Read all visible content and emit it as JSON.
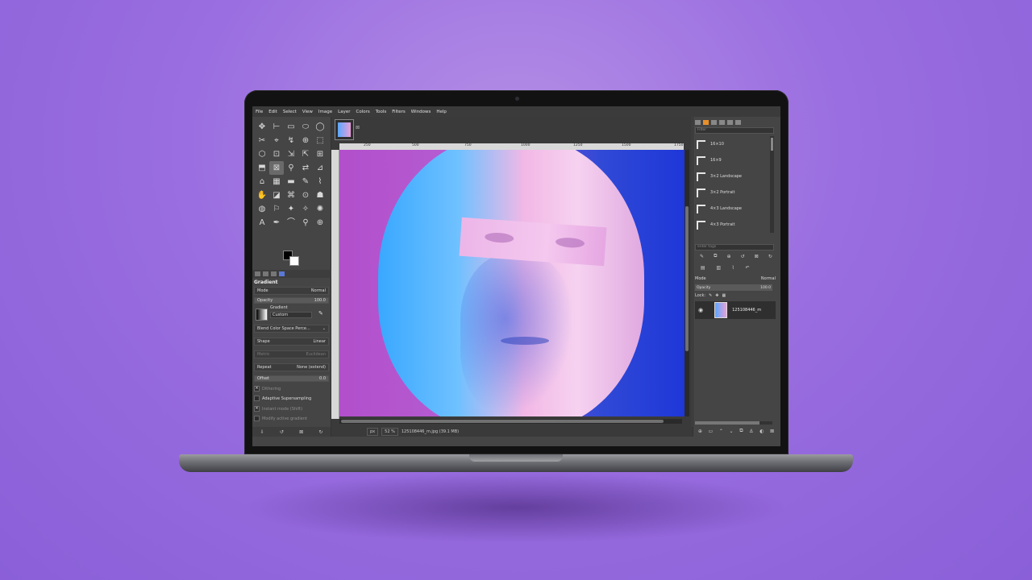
{
  "menu": [
    "File",
    "Edit",
    "Select",
    "View",
    "Image",
    "Layer",
    "Colors",
    "Tools",
    "Filters",
    "Windows",
    "Help"
  ],
  "tools": [
    "✥",
    "⊢",
    "▭",
    "⬭",
    "◯",
    "✂",
    "⌖",
    "↯",
    "⊕",
    "⬚",
    "⬡",
    "⊡",
    "⇲",
    "⇱",
    "⊞",
    "⬒",
    "⊠",
    "⚲",
    "⇄",
    "⊿",
    "⌂",
    "▦",
    "▬",
    "✎",
    "⌇",
    "✋",
    "◪",
    "⌘",
    "⊙",
    "☗",
    "◍",
    "⚐",
    "✦",
    "✧",
    "✺",
    "A",
    "✒",
    "⌒",
    "⚲",
    "⊕"
  ],
  "tool_options": {
    "title": "Gradient",
    "mode_label": "Mode",
    "mode_value": "Normal",
    "opacity_label": "Opacity",
    "opacity_value": "100.0",
    "gradient_label": "Gradient",
    "gradient_value": "Custom",
    "blend_label": "Blend Color Space Perce...",
    "shape_label": "Shape",
    "shape_value": "Linear",
    "metric_label": "Metric",
    "metric_value": "Euclidean",
    "repeat_label": "Repeat",
    "repeat_value": "None (extend)",
    "offset_label": "Offset",
    "offset_value": "0.0",
    "dithering": "Dithering",
    "adaptive": "Adaptive Supersampling",
    "instant": "Instant mode  (Shift)",
    "modify": "Modify active gradient"
  },
  "ruler": [
    "250",
    "500",
    "750",
    "1000",
    "1250",
    "1500",
    "1750"
  ],
  "status": {
    "unit": "px",
    "zoom": "52 %",
    "file": "125108446_m.jpg (39.1 MB)"
  },
  "dock": {
    "filter_placeholder": "Filter",
    "presets": [
      "16×10",
      "16×9",
      "3×2 Landscape",
      "3×2 Portrait",
      "4×3 Landscape",
      "4×3 Portrait"
    ],
    "tags_placeholder": "enter tags",
    "layer_mode_label": "Mode",
    "layer_mode_value": "Normal",
    "layer_opacity_label": "Opacity",
    "layer_opacity_value": "100.0",
    "lock_label": "Lock:",
    "layer_name": "125108446_m"
  }
}
